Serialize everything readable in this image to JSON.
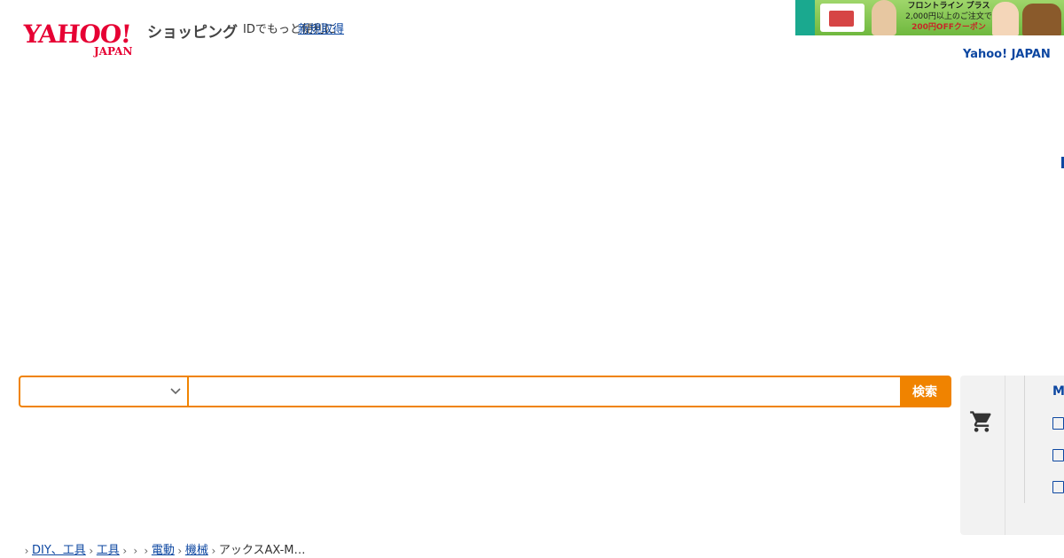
{
  "header": {
    "logo_main": "YAHOO!",
    "logo_sub": "JAPAN",
    "brand_label": "ショッピング",
    "id_text": "IDでもっと便利に",
    "id_link": "新規取得",
    "yahoo_japan_link": "Yahoo! JAPAN"
  },
  "banner": {
    "line1": "フロントライン プラス",
    "line2": "2,000円以上のご注文で",
    "line3": "200円OFFクーポン"
  },
  "search": {
    "category_value": "",
    "query_value": "",
    "query_placeholder": "",
    "button_label": "検索"
  },
  "cart": {
    "header_text": "M"
  },
  "breadcrumb": {
    "items": [
      "DIY、工具",
      "工具",
      "",
      "",
      "電動",
      "機械",
      "アックスAX-M…"
    ]
  },
  "colors": {
    "accent": "#f08300",
    "link": "#0d47a1",
    "brand_red": "#e60033"
  }
}
